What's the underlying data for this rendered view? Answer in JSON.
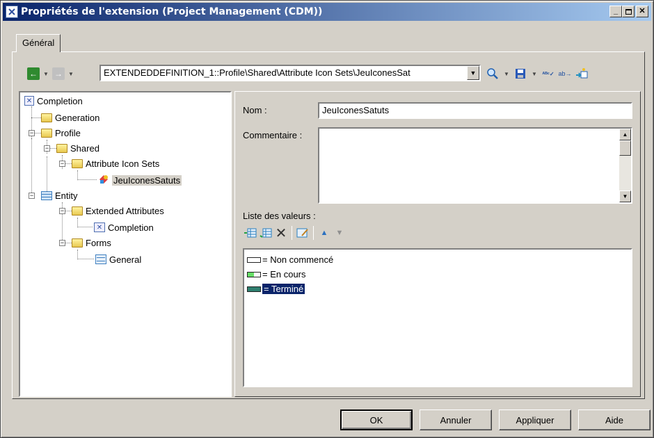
{
  "window": {
    "title": "Propriétés de l'extension (Project Management (CDM))"
  },
  "tabs": [
    {
      "label": "Général"
    }
  ],
  "path_combo": {
    "value": "EXTENDEDDEFINITION_1::Profile\\Shared\\Attribute Icon Sets\\JeuIconesSat"
  },
  "toolbar": {
    "icons": [
      "back-arrow-icon",
      "forward-arrow-icon",
      "find-icon",
      "save-icon",
      "spell-check-icon",
      "replace-icon",
      "apply-template-icon"
    ]
  },
  "tree": {
    "items": [
      {
        "label": "Completion",
        "icon": "extended-attribute-icon"
      },
      {
        "label": "Generation",
        "icon": "folder-icon"
      },
      {
        "label": "Profile",
        "icon": "folder-icon"
      },
      {
        "label": "Shared",
        "icon": "folder-icon"
      },
      {
        "label": "Attribute Icon Sets",
        "icon": "folder-icon"
      },
      {
        "label": "JeuIconesSatuts",
        "icon": "icon-set-icon"
      },
      {
        "label": "Entity",
        "icon": "table-icon"
      },
      {
        "label": "Extended Attributes",
        "icon": "folder-icon"
      },
      {
        "label": "Completion",
        "icon": "extended-attribute-icon"
      },
      {
        "label": "Forms",
        "icon": "folder-icon"
      },
      {
        "label": "General",
        "icon": "form-icon"
      }
    ]
  },
  "form": {
    "name_label": "Nom :",
    "name_value": "JeuIconesSatuts",
    "comment_label": "Commentaire :",
    "comment_value": "",
    "values_label": "Liste des valeurs :"
  },
  "values_list": {
    "items": [
      {
        "label": "= Non commencé",
        "color": "#ffffff"
      },
      {
        "label": "= En cours",
        "color": "#66dd66"
      },
      {
        "label": "= Terminé",
        "color": "#2f7f6f"
      }
    ]
  },
  "buttons": {
    "ok": "OK",
    "cancel": "Annuler",
    "apply": "Appliquer",
    "help": "Aide"
  }
}
